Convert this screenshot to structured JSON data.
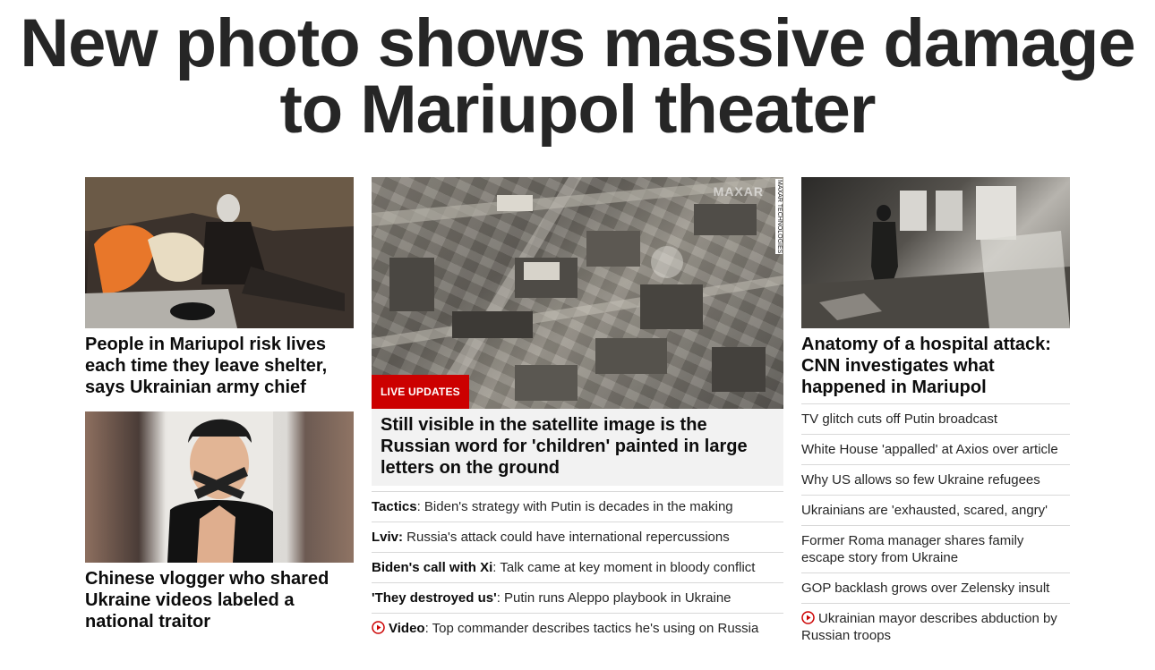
{
  "headline": "New photo shows massive damage to Mariupol theater",
  "left": {
    "cards": [
      {
        "title": "People in Mariupol risk lives each time they leave shelter, says Ukrainian army chief"
      },
      {
        "title": "Chinese vlogger who shared Ukraine videos labeled a national traitor"
      }
    ]
  },
  "middle": {
    "badge": "LIVE UPDATES",
    "watermark": "MAXAR",
    "image_credit": "MAXAR TECHNOLOGIES",
    "title": "Still visible in the satellite image is the Russian word for 'children' painted in large letters on the ground",
    "links": [
      {
        "prefix": "Tactics",
        "text": ": Biden's strategy with Putin is decades in the making"
      },
      {
        "prefix": "Lviv:",
        "text": " Russia's attack could have international repercussions"
      },
      {
        "prefix": "Biden's call with Xi",
        "text": ": Talk came at key moment in bloody conflict"
      },
      {
        "prefix": "'They destroyed us'",
        "text": ": Putin runs Aleppo playbook in Ukraine"
      },
      {
        "prefix": "Video",
        "text": ": Top commander describes tactics he's using on Russia",
        "icon": "video-play-icon"
      }
    ]
  },
  "right": {
    "title": "Anatomy of a hospital attack: CNN investigates what happened in Mariupol",
    "links": [
      {
        "text": "TV glitch cuts off Putin broadcast"
      },
      {
        "text": "White House 'appalled' at Axios over article"
      },
      {
        "text": "Why US allows so few Ukraine refugees"
      },
      {
        "text": "Ukrainians are 'exhausted, scared, angry'"
      },
      {
        "text": "Former Roma manager shares family escape story from Ukraine"
      },
      {
        "text": "GOP backlash grows over Zelensky insult"
      },
      {
        "text": "Ukrainian mayor describes abduction by Russian troops",
        "icon": "video-play-icon"
      }
    ]
  },
  "colors": {
    "accent": "#cc0000",
    "text": "#262626",
    "divider": "#d8d8d8"
  }
}
